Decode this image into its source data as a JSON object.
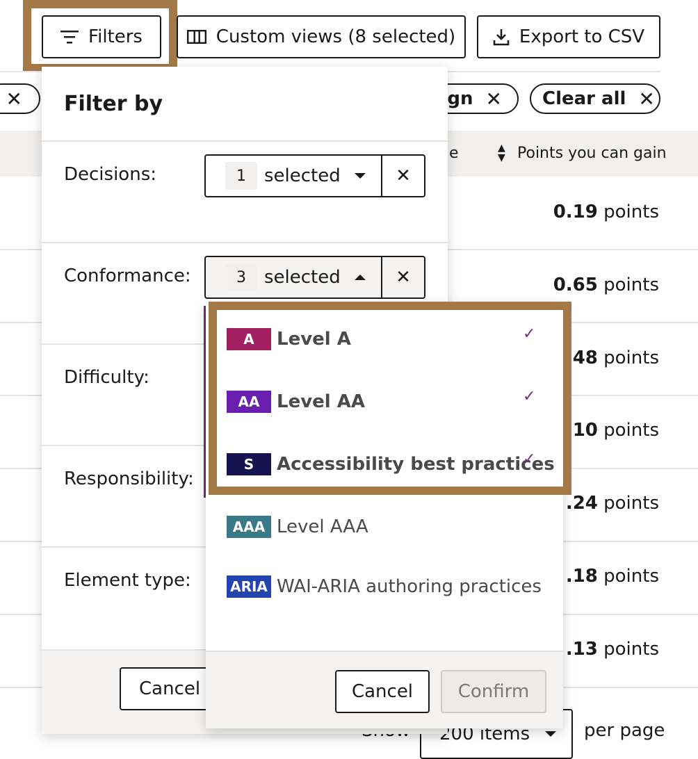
{
  "toolbar": {
    "filters_label": "Filters",
    "custom_views_label": "Custom views (8 selected)",
    "export_label": "Export to CSV"
  },
  "chips": {
    "partial_label": "ign",
    "clear_all_label": "Clear all"
  },
  "table": {
    "partial_header": "e",
    "points_header": "Points you can gain",
    "rows": [
      {
        "value": "0.19",
        "unit": "points"
      },
      {
        "value": "0.65",
        "unit": "points"
      },
      {
        "value": ".48",
        "unit": "points"
      },
      {
        "value": ".10",
        "unit": "points"
      },
      {
        "value": ".24",
        "unit": "points"
      },
      {
        "value": ".18",
        "unit": "points"
      },
      {
        "value": ".13",
        "unit": "points"
      }
    ]
  },
  "pagination": {
    "show_label": "Show",
    "items_value": "200 items",
    "per_page_label": "per page"
  },
  "filter_panel": {
    "title": "Filter by",
    "decisions_label": "Decisions:",
    "decisions_count": "1",
    "decisions_text": "selected",
    "conformance_label": "Conformance:",
    "conformance_count": "3",
    "conformance_text": "selected",
    "difficulty_label": "Difficulty:",
    "responsibility_label": "Responsibility:",
    "element_type_label": "Element type:",
    "cancel_label": "Cancel"
  },
  "conformance_dropdown": {
    "options": [
      {
        "badge": "A",
        "label": "Level A",
        "badge_color": "#a3205e",
        "checked": true
      },
      {
        "badge": "AA",
        "label": "Level AA",
        "badge_color": "#6a1fb0",
        "checked": true
      },
      {
        "badge": "S",
        "label": "Accessibility best practices",
        "badge_color": "#14124f",
        "checked": true
      },
      {
        "badge": "AAA",
        "label": "Level AAA",
        "badge_color": "#3a7a88",
        "checked": false
      },
      {
        "badge": "ARIA",
        "label": "WAI-ARIA authoring practices",
        "badge_color": "#2344b0",
        "checked": false
      }
    ],
    "check_glyph": "✓",
    "cancel_label": "Cancel",
    "confirm_label": "Confirm"
  },
  "colors": {
    "highlight": "#a37a47",
    "check": "#7a2a7a"
  }
}
